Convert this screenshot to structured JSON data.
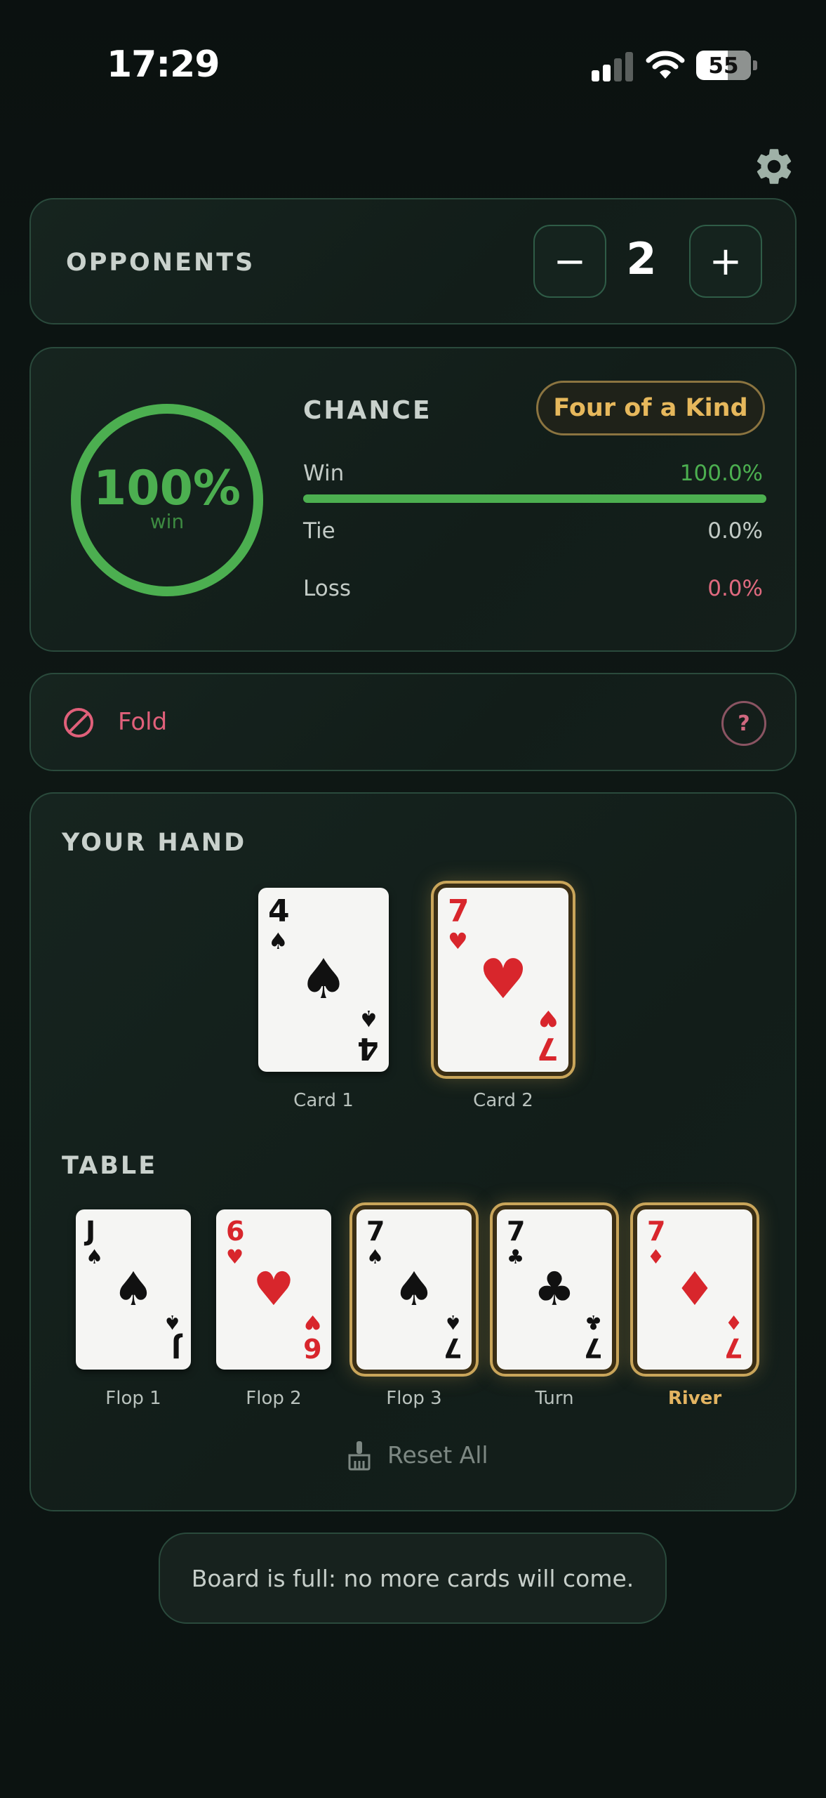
{
  "status_bar": {
    "time": "17:29",
    "battery": "55",
    "signal_bars": 2,
    "signal_total": 4
  },
  "settings": {
    "icon": "gear-icon"
  },
  "opponents": {
    "label": "OPPONENTS",
    "count": "2",
    "minus": "−",
    "plus": "+"
  },
  "chance": {
    "title": "CHANCE",
    "hand_rank": "Four of a Kind",
    "ring_value": "100%",
    "ring_sub": "win",
    "win_fraction": 1.0,
    "rows": [
      {
        "label": "Win",
        "value": "100.0%",
        "color": "#4caf50"
      },
      {
        "label": "Tie",
        "value": "0.0%",
        "color": "#c3cbc6"
      },
      {
        "label": "Loss",
        "value": "0.0%",
        "color": "#e06a7f"
      }
    ]
  },
  "action": {
    "label": "Fold",
    "icon": "prohibit-icon",
    "help": "?"
  },
  "your_hand": {
    "title": "YOUR HAND",
    "cards": [
      {
        "rank": "4",
        "suit": "♠",
        "color": "black",
        "caption": "Card 1",
        "highlighted": false
      },
      {
        "rank": "7",
        "suit": "♥",
        "color": "red",
        "caption": "Card 2",
        "highlighted": true
      }
    ]
  },
  "table": {
    "title": "TABLE",
    "cards": [
      {
        "rank": "J",
        "suit": "♠",
        "color": "black",
        "caption": "Flop 1",
        "highlighted": false
      },
      {
        "rank": "6",
        "suit": "♥",
        "color": "red",
        "caption": "Flop 2",
        "highlighted": false
      },
      {
        "rank": "7",
        "suit": "♠",
        "color": "black",
        "caption": "Flop 3",
        "highlighted": true
      },
      {
        "rank": "7",
        "suit": "♣",
        "color": "black",
        "caption": "Turn",
        "highlighted": true
      },
      {
        "rank": "7",
        "suit": "♦",
        "color": "red",
        "caption": "River",
        "highlighted": true
      }
    ]
  },
  "reset": {
    "label": "Reset All",
    "icon": "broom-icon"
  },
  "toast": {
    "message": "Board is full: no more cards will come."
  }
}
